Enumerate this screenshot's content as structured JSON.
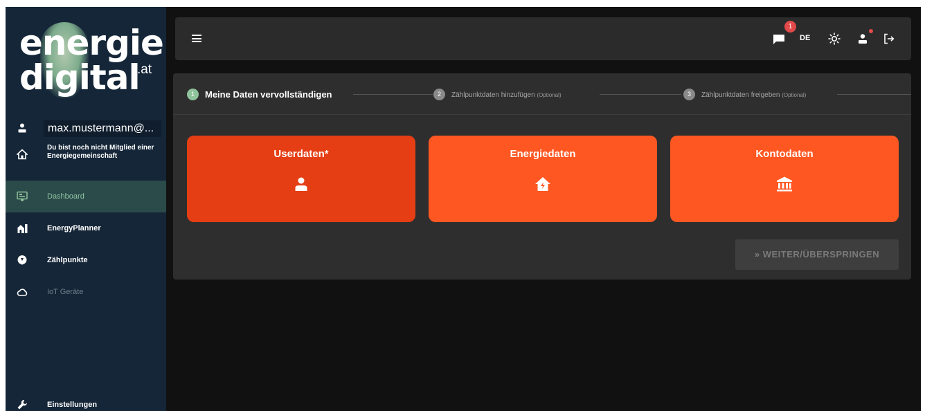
{
  "logo": {
    "line1": "energie",
    "line2": "digital",
    "tld": ".at"
  },
  "user": {
    "email": "max.mustermann@..."
  },
  "membership": {
    "text": "Du bist noch nicht Mitglied einer Energiegemeinschaft"
  },
  "nav": {
    "items": [
      {
        "label": "Dashboard",
        "icon": "dashboard-icon",
        "state": "active"
      },
      {
        "label": "EnergyPlanner",
        "icon": "house-bar-icon",
        "state": "normal"
      },
      {
        "label": "Zählpunkte",
        "icon": "meter-point-icon",
        "state": "normal"
      },
      {
        "label": "IoT Geräte",
        "icon": "cloud-icon",
        "state": "disabled"
      }
    ],
    "settings": {
      "label": "Einstellungen",
      "icon": "wrench-icon"
    }
  },
  "header": {
    "notification_count": "1",
    "language": "DE"
  },
  "stepper": {
    "steps": [
      {
        "num": "1",
        "label": "Meine Daten vervollständigen",
        "optional": "",
        "state": "active"
      },
      {
        "num": "2",
        "label": "Zählpunktdaten hinzufügen",
        "optional": "(Optional)",
        "state": "inactive"
      },
      {
        "num": "3",
        "label": "Zählpunktdaten freigeben",
        "optional": "(Optional)",
        "state": "inactive"
      }
    ]
  },
  "tiles": [
    {
      "title": "Userdaten*",
      "icon": "person-icon"
    },
    {
      "title": "Energiedaten",
      "icon": "house-bolt-icon"
    },
    {
      "title": "Kontodaten",
      "icon": "bank-icon"
    }
  ],
  "actions": {
    "skip_label": "» WEITER/ÜBERSPRINGEN"
  },
  "colors": {
    "sidebar": "#152638",
    "accent_orange": "#ff5722",
    "accent_orange_active": "#e53e14",
    "accent_green": "#8fc39b",
    "badge_red": "#e24a4a"
  }
}
